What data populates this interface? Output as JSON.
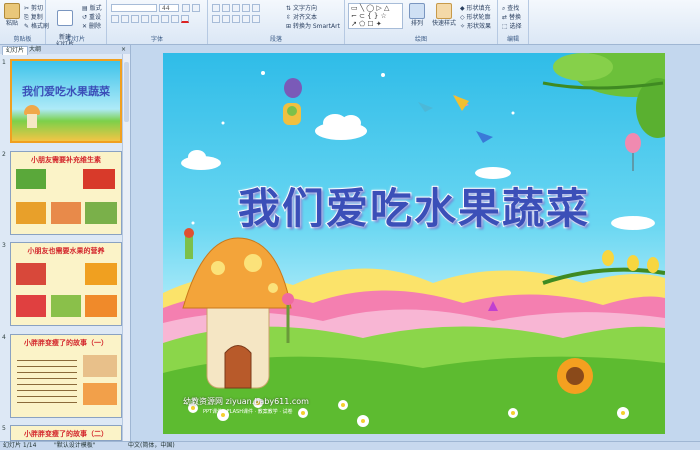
{
  "ribbon": {
    "clipboard": {
      "label": "剪贴板",
      "paste": "粘贴",
      "cut": "剪切",
      "copy": "复制",
      "format_painter": "格式刷"
    },
    "slides": {
      "label": "幻灯片",
      "new_slide": "新建\n幻灯片",
      "layout": "版式",
      "reset": "重设",
      "delete": "删除"
    },
    "font": {
      "label": "字体",
      "size": "44"
    },
    "paragraph": {
      "label": "段落",
      "text_direction": "文字方向",
      "align_text": "对齐文本",
      "smartart": "转换为 SmartArt"
    },
    "drawing": {
      "label": "绘图",
      "arrange": "排列",
      "quick_styles": "快速样式",
      "shape_fill": "形状填充",
      "shape_outline": "形状轮廓",
      "shape_effects": "形状效果"
    },
    "editing": {
      "label": "编辑",
      "find": "查找",
      "replace": "替换",
      "select": "选择"
    }
  },
  "panel": {
    "tabs": [
      "幻灯片",
      "大纲"
    ],
    "thumbnails": [
      {
        "num": "1",
        "title": "我们爱吃水果蔬菜"
      },
      {
        "num": "2",
        "title": "小朋友需要补充维生素"
      },
      {
        "num": "3",
        "title": "小朋友也需要水果的营养"
      },
      {
        "num": "4",
        "title": "小胖胖变瘦了的故事（一）"
      },
      {
        "num": "5",
        "title": "小胖胖变瘦了的故事（二）"
      }
    ]
  },
  "slide": {
    "title": "我们爱吃水果蔬菜",
    "watermark": "幼教资源网 ziyuan.baby611.com",
    "watermark_sub": "PPT课件 · FLASH课件 · 教案教学 · 试卷"
  },
  "status": {
    "slide_info": "幻灯片 1/14",
    "theme": "\"默认设计模板\"",
    "language": "中文(简体，中国)"
  }
}
